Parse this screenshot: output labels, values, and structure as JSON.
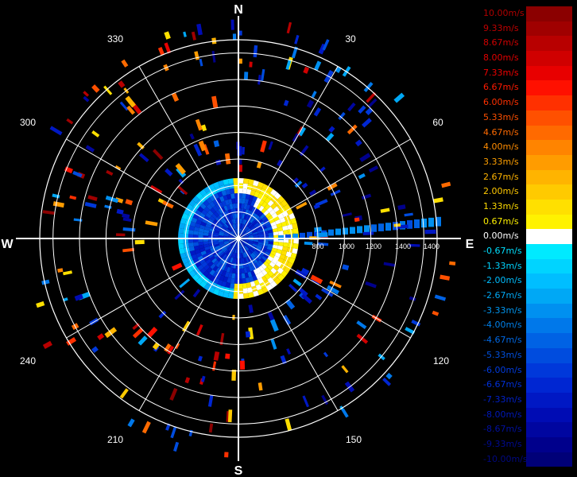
{
  "chart_data": {
    "type": "polar",
    "compass": {
      "north": "N",
      "south": "S",
      "east": "E",
      "west": "W"
    },
    "angle_labels": [
      "30",
      "60",
      "120",
      "150",
      "210",
      "240",
      "300",
      "330"
    ],
    "range_labels": [
      "800",
      "1000",
      "1200",
      "1400"
    ],
    "range_rings": [
      200,
      400,
      600,
      800,
      1000,
      1200,
      1400
    ],
    "max_range": 1500,
    "grid": true,
    "legend": "right",
    "velocity_scale": [
      {
        "label": "10.00m/s",
        "color": "#8b0000",
        "text_color": "#b00000"
      },
      {
        "label": "9.33m/s",
        "color": "#a00000",
        "text_color": "#c00000"
      },
      {
        "label": "8.67m/s",
        "color": "#b80000",
        "text_color": "#d00000"
      },
      {
        "label": "8.00m/s",
        "color": "#d00000",
        "text_color": "#e00000"
      },
      {
        "label": "7.33m/s",
        "color": "#e80000",
        "text_color": "#f00000"
      },
      {
        "label": "6.67m/s",
        "color": "#ff1000",
        "text_color": "#ff1a00"
      },
      {
        "label": "6.00m/s",
        "color": "#ff3000",
        "text_color": "#ff3000"
      },
      {
        "label": "5.33m/s",
        "color": "#ff5000",
        "text_color": "#ff5000"
      },
      {
        "label": "4.67m/s",
        "color": "#ff6a00",
        "text_color": "#ff6a00"
      },
      {
        "label": "4.00m/s",
        "color": "#ff8400",
        "text_color": "#ff8c00"
      },
      {
        "label": "3.33m/s",
        "color": "#ff9c00",
        "text_color": "#ffa000"
      },
      {
        "label": "2.67m/s",
        "color": "#ffb400",
        "text_color": "#ffb400"
      },
      {
        "label": "2.00m/s",
        "color": "#ffca00",
        "text_color": "#ffc800"
      },
      {
        "label": "1.33m/s",
        "color": "#ffe000",
        "text_color": "#ffdc00"
      },
      {
        "label": "0.67m/s",
        "color": "#fff200",
        "text_color": "#fff000"
      },
      {
        "label": "0.00m/s",
        "color": "#ffffff",
        "text_color": "#ffffff"
      },
      {
        "label": "-0.67m/s",
        "color": "#00eaff",
        "text_color": "#00e0ff"
      },
      {
        "label": "-1.33m/s",
        "color": "#00d4ff",
        "text_color": "#00d4ff"
      },
      {
        "label": "-2.00m/s",
        "color": "#00beff",
        "text_color": "#00beff"
      },
      {
        "label": "-2.67m/s",
        "color": "#00a8f5",
        "text_color": "#00a8f5"
      },
      {
        "label": "-3.33m/s",
        "color": "#0090f0",
        "text_color": "#0096f0"
      },
      {
        "label": "-4.00m/s",
        "color": "#0078ea",
        "text_color": "#0080ea"
      },
      {
        "label": "-4.67m/s",
        "color": "#0062e4",
        "text_color": "#0068e4"
      },
      {
        "label": "-5.33m/s",
        "color": "#004cde",
        "text_color": "#0050de"
      },
      {
        "label": "-6.00m/s",
        "color": "#0038da",
        "text_color": "#003ce0"
      },
      {
        "label": "-6.67m/s",
        "color": "#0026d2",
        "text_color": "#0030d8"
      },
      {
        "label": "-7.33m/s",
        "color": "#0018c4",
        "text_color": "#0020c8"
      },
      {
        "label": "-8.00m/s",
        "color": "#000cb4",
        "text_color": "#0018b8"
      },
      {
        "label": "-8.67m/s",
        "color": "#0006a0",
        "text_color": "#0010a0"
      },
      {
        "label": "-9.33m/s",
        "color": "#00008c",
        "text_color": "#000a90"
      },
      {
        "label": "-10.00m/s",
        "color": "#000078",
        "text_color": "#000880"
      }
    ]
  }
}
